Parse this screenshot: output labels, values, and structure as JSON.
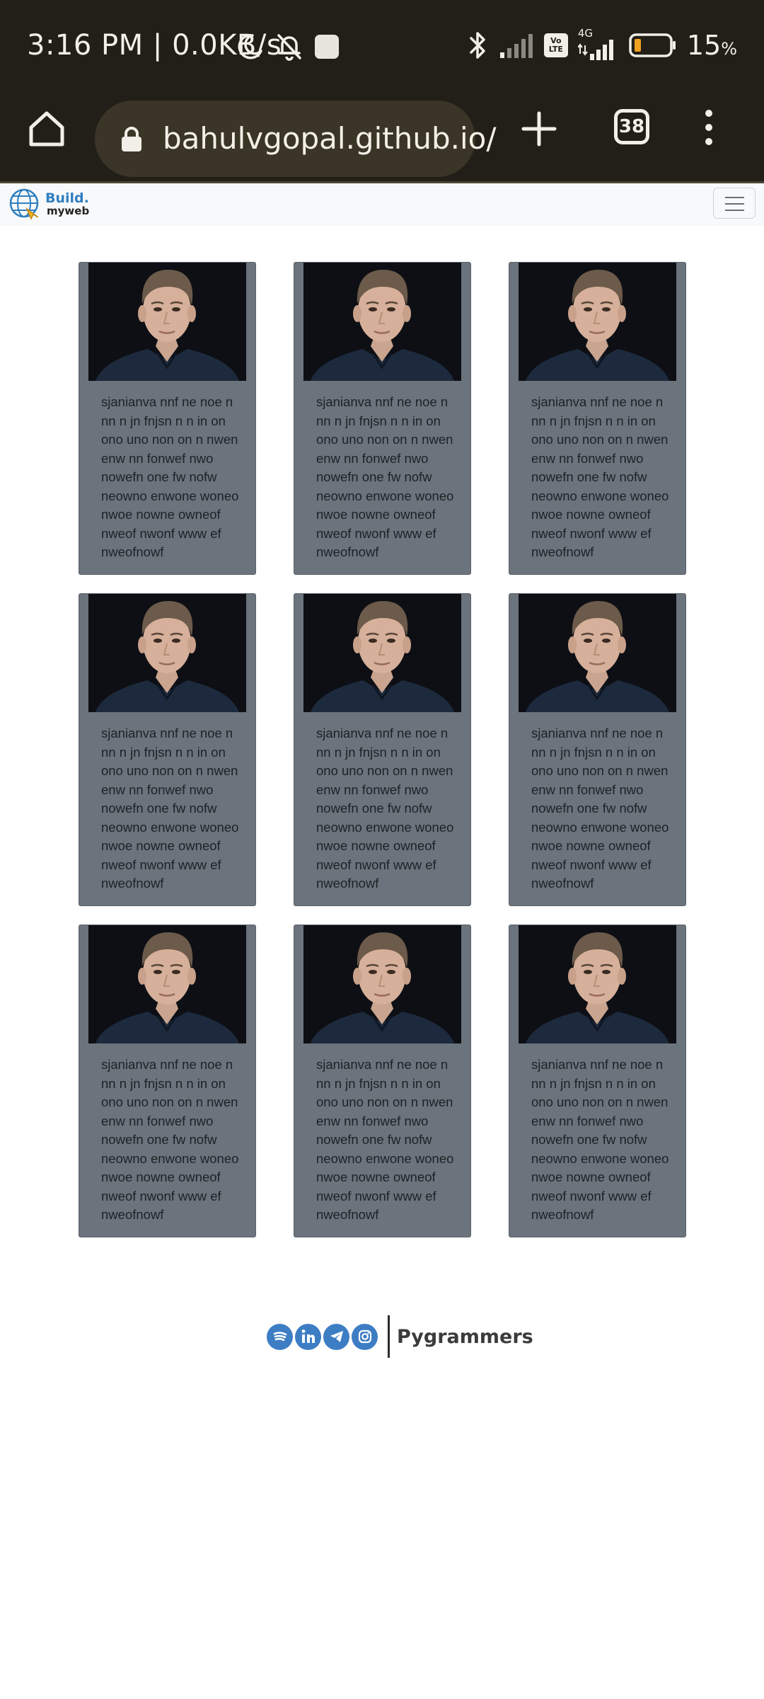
{
  "status_bar": {
    "time": "3:16 PM | 0.0KB/s",
    "volte": "Vo LTE",
    "network": "4G",
    "battery_pct": "15",
    "battery_unit": "%"
  },
  "browser": {
    "url": "bahulvgopal.github.io/",
    "tab_count": "38"
  },
  "site": {
    "brand_top": "Build.",
    "brand_bottom": "myweb"
  },
  "cards": [
    {
      "text": "sjanianva nnf ne noe n nn n jn fnjsn n n in on ono uno non on n nwen enw nn fonwef nwo nowefn one fw nofw neowno enwone woneo nwoe nowne owneof nweof nwonf www ef nweofnowf"
    },
    {
      "text": "sjanianva nnf ne noe n nn n jn fnjsn n n in on ono uno non on n nwen enw nn fonwef nwo nowefn one fw nofw neowno enwone woneo nwoe nowne owneof nweof nwonf www ef nweofnowf"
    },
    {
      "text": "sjanianva nnf ne noe n nn n jn fnjsn n n in on ono uno non on n nwen enw nn fonwef nwo nowefn one fw nofw neowno enwone woneo nwoe nowne owneof nweof nwonf www ef nweofnowf"
    },
    {
      "text": "sjanianva nnf ne noe n nn n jn fnjsn n n in on ono uno non on n nwen enw nn fonwef nwo nowefn one fw nofw neowno enwone woneo nwoe nowne owneof nweof nwonf www ef nweofnowf"
    },
    {
      "text": "sjanianva nnf ne noe n nn n jn fnjsn n n in on ono uno non on n nwen enw nn fonwef nwo nowefn one fw nofw neowno enwone woneo nwoe nowne owneof nweof nwonf www ef nweofnowf"
    },
    {
      "text": "sjanianva nnf ne noe n nn n jn fnjsn n n in on ono uno non on n nwen enw nn fonwef nwo nowefn one fw nofw neowno enwone woneo nwoe nowne owneof nweof nwonf www ef nweofnowf"
    },
    {
      "text": "sjanianva nnf ne noe n nn n jn fnjsn n n in on ono uno non on n nwen enw nn fonwef nwo nowefn one fw nofw neowno enwone woneo nwoe nowne owneof nweof nwonf www ef nweofnowf"
    },
    {
      "text": "sjanianva nnf ne noe n nn n jn fnjsn n n in on ono uno non on n nwen enw nn fonwef nwo nowefn one fw nofw neowno enwone woneo nwoe nowne owneof nweof nwonf www ef nweofnowf"
    },
    {
      "text": "sjanianva nnf ne noe n nn n jn fnjsn n n in on ono uno non on n nwen enw nn fonwef nwo nowefn one fw nofw neowno enwone woneo nwoe nowne owneof nweof nwonf www ef nweofnowf"
    }
  ],
  "footer": {
    "social_icons": [
      "spotify-icon",
      "linkedin-icon",
      "telegram-icon",
      "instagram-icon"
    ],
    "brand": "Pygrammers"
  },
  "colors": {
    "chrome_bg": "#221f19",
    "url_pill_bg": "#3a3526",
    "card_bg": "#6b737c",
    "brand_blue": "#2f7fc0",
    "social_blue": "#3d7dc4",
    "battery_low": "#f0a020"
  }
}
